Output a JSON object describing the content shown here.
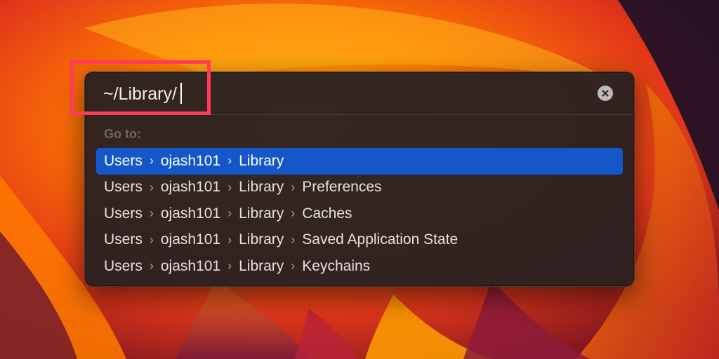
{
  "goto_panel": {
    "path_value": "~/Library/",
    "section_label": "Go to:",
    "separator_glyph": "›",
    "results": [
      {
        "segments": [
          "Users",
          "ojash101",
          "Library"
        ],
        "selected": true
      },
      {
        "segments": [
          "Users",
          "ojash101",
          "Library",
          "Preferences"
        ],
        "selected": false
      },
      {
        "segments": [
          "Users",
          "ojash101",
          "Library",
          "Caches"
        ],
        "selected": false
      },
      {
        "segments": [
          "Users",
          "ojash101",
          "Library",
          "Saved Application State"
        ],
        "selected": false
      },
      {
        "segments": [
          "Users",
          "ojash101",
          "Library",
          "Keychains"
        ],
        "selected": false
      }
    ]
  },
  "icons": {
    "clear": "close-circle-icon",
    "separator": "chevron-right-icon"
  },
  "colors": {
    "selection": "#1556c9",
    "annotation_box": "#ff3c57",
    "panel_bg": "#2b2121"
  }
}
